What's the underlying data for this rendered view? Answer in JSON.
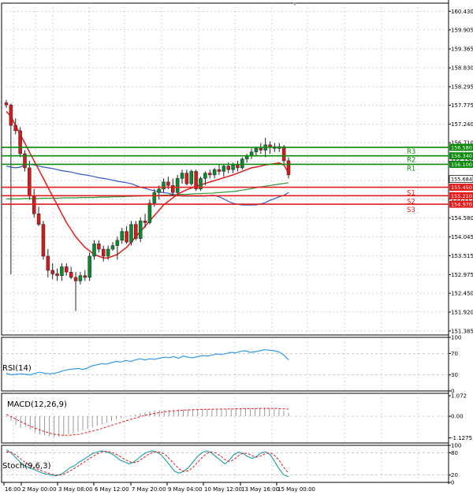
{
  "colors": {
    "background": "#ffffff",
    "grid": "#b8b8b8",
    "panel_border": "#000000",
    "bull_candle": "#0a8a2e",
    "bear_candle": "#d61a1a",
    "ema_red": "#e31b1b",
    "ma_blue": "#3355cc",
    "ma_green": "#2a9a3a",
    "resistance": "#0a8a0a",
    "support": "#e31b1b",
    "price_tag": "#ffffff",
    "rsi": "#3399ee",
    "macd_hist": "#999999",
    "macd_signal": "#e31b1b",
    "stoch_main": "#1aa0a0",
    "stoch_signal": "#e31b1b"
  },
  "chart_data": {
    "type": "candlestick",
    "price_panel": {
      "ylim": [
        151.27,
        160.66
      ],
      "price_ticks": [
        "160.430",
        "159.905",
        "159.365",
        "158.830",
        "158.295",
        "157.775",
        "157.240",
        "156.710",
        "156.175",
        "155.640",
        "155.115",
        "154.580",
        "154.045",
        "153.515",
        "152.975",
        "152.450",
        "151.920",
        "151.385"
      ],
      "candles": [
        {
          "o": 157.84,
          "h": 157.92,
          "l": 157.7,
          "c": 157.78
        },
        {
          "o": 157.78,
          "h": 157.82,
          "l": 152.99,
          "c": 157.2
        },
        {
          "o": 157.2,
          "h": 157.4,
          "l": 156.95,
          "c": 157.05
        },
        {
          "o": 157.05,
          "h": 157.15,
          "l": 156.3,
          "c": 156.4
        },
        {
          "o": 156.4,
          "h": 156.5,
          "l": 155.9,
          "c": 156.0
        },
        {
          "o": 156.0,
          "h": 156.2,
          "l": 155.1,
          "c": 155.2
        },
        {
          "o": 155.2,
          "h": 155.4,
          "l": 154.6,
          "c": 154.7
        },
        {
          "o": 154.7,
          "h": 154.9,
          "l": 154.35,
          "c": 154.4
        },
        {
          "o": 154.4,
          "h": 154.5,
          "l": 153.4,
          "c": 153.5
        },
        {
          "o": 153.5,
          "h": 153.7,
          "l": 152.9,
          "c": 153.1
        },
        {
          "o": 153.1,
          "h": 153.3,
          "l": 152.85,
          "c": 153.0
        },
        {
          "o": 153.0,
          "h": 153.15,
          "l": 152.8,
          "c": 152.95
        },
        {
          "o": 152.95,
          "h": 153.3,
          "l": 152.8,
          "c": 153.2
        },
        {
          "o": 153.2,
          "h": 153.3,
          "l": 152.95,
          "c": 153.05
        },
        {
          "o": 153.05,
          "h": 153.2,
          "l": 152.85,
          "c": 152.9
        },
        {
          "o": 152.9,
          "h": 153.05,
          "l": 151.95,
          "c": 152.8
        },
        {
          "o": 152.8,
          "h": 153.05,
          "l": 152.7,
          "c": 152.95
        },
        {
          "o": 152.95,
          "h": 153.1,
          "l": 152.8,
          "c": 152.9
        },
        {
          "o": 152.9,
          "h": 153.6,
          "l": 152.8,
          "c": 153.5
        },
        {
          "o": 153.5,
          "h": 153.95,
          "l": 153.4,
          "c": 153.85
        },
        {
          "o": 153.85,
          "h": 153.95,
          "l": 153.6,
          "c": 153.7
        },
        {
          "o": 153.7,
          "h": 153.8,
          "l": 153.35,
          "c": 153.5
        },
        {
          "o": 153.5,
          "h": 153.8,
          "l": 153.4,
          "c": 153.7
        },
        {
          "o": 153.7,
          "h": 153.9,
          "l": 153.65,
          "c": 153.8
        },
        {
          "o": 153.8,
          "h": 154.05,
          "l": 153.4,
          "c": 153.95
        },
        {
          "o": 153.95,
          "h": 154.3,
          "l": 153.85,
          "c": 154.2
        },
        {
          "o": 154.2,
          "h": 154.35,
          "l": 153.85,
          "c": 153.9
        },
        {
          "o": 153.9,
          "h": 154.5,
          "l": 153.8,
          "c": 154.4
        },
        {
          "o": 154.4,
          "h": 154.5,
          "l": 153.95,
          "c": 154.0
        },
        {
          "o": 154.0,
          "h": 154.6,
          "l": 153.9,
          "c": 154.5
        },
        {
          "o": 154.5,
          "h": 154.7,
          "l": 154.3,
          "c": 154.45
        },
        {
          "o": 154.45,
          "h": 155.1,
          "l": 154.4,
          "c": 155.0
        },
        {
          "o": 155.0,
          "h": 155.4,
          "l": 154.9,
          "c": 155.3
        },
        {
          "o": 155.3,
          "h": 155.5,
          "l": 155.1,
          "c": 155.4
        },
        {
          "o": 155.4,
          "h": 155.7,
          "l": 155.3,
          "c": 155.6
        },
        {
          "o": 155.6,
          "h": 155.75,
          "l": 155.4,
          "c": 155.5
        },
        {
          "o": 155.5,
          "h": 155.7,
          "l": 155.2,
          "c": 155.3
        },
        {
          "o": 155.3,
          "h": 155.8,
          "l": 155.25,
          "c": 155.7
        },
        {
          "o": 155.7,
          "h": 155.95,
          "l": 155.55,
          "c": 155.85
        },
        {
          "o": 155.85,
          "h": 155.95,
          "l": 155.5,
          "c": 155.55
        },
        {
          "o": 155.55,
          "h": 155.95,
          "l": 155.5,
          "c": 155.9
        },
        {
          "o": 155.9,
          "h": 155.95,
          "l": 155.35,
          "c": 155.4
        },
        {
          "o": 155.4,
          "h": 155.75,
          "l": 155.35,
          "c": 155.7
        },
        {
          "o": 155.7,
          "h": 155.9,
          "l": 155.5,
          "c": 155.85
        },
        {
          "o": 155.85,
          "h": 155.95,
          "l": 155.7,
          "c": 155.8
        },
        {
          "o": 155.8,
          "h": 156.0,
          "l": 155.7,
          "c": 155.95
        },
        {
          "o": 155.95,
          "h": 156.1,
          "l": 155.8,
          "c": 155.9
        },
        {
          "o": 155.9,
          "h": 156.1,
          "l": 155.75,
          "c": 156.05
        },
        {
          "o": 156.05,
          "h": 156.15,
          "l": 155.85,
          "c": 155.95
        },
        {
          "o": 155.95,
          "h": 156.15,
          "l": 155.85,
          "c": 156.1
        },
        {
          "o": 156.1,
          "h": 156.2,
          "l": 155.9,
          "c": 156.0
        },
        {
          "o": 156.0,
          "h": 156.3,
          "l": 155.95,
          "c": 156.25
        },
        {
          "o": 156.25,
          "h": 156.4,
          "l": 156.15,
          "c": 156.35
        },
        {
          "o": 156.35,
          "h": 156.55,
          "l": 156.25,
          "c": 156.45
        },
        {
          "o": 156.45,
          "h": 156.6,
          "l": 156.35,
          "c": 156.55
        },
        {
          "o": 156.55,
          "h": 156.7,
          "l": 156.4,
          "c": 156.5
        },
        {
          "o": 156.5,
          "h": 156.85,
          "l": 156.3,
          "c": 156.65
        },
        {
          "o": 156.65,
          "h": 156.75,
          "l": 156.4,
          "c": 156.6
        },
        {
          "o": 156.6,
          "h": 156.7,
          "l": 156.45,
          "c": 156.55
        },
        {
          "o": 156.55,
          "h": 156.7,
          "l": 156.45,
          "c": 156.6
        },
        {
          "o": 156.6,
          "h": 156.65,
          "l": 156.1,
          "c": 156.2
        },
        {
          "o": 156.2,
          "h": 156.3,
          "l": 155.7,
          "c": 155.8
        }
      ],
      "indicator_lines": {
        "ema_red": [
          157.6,
          157.45,
          157.2,
          156.95,
          156.7,
          156.45,
          156.2,
          155.95,
          155.7,
          155.45,
          155.2,
          154.95,
          154.7,
          154.45,
          154.25,
          154.05,
          153.9,
          153.75,
          153.65,
          153.55,
          153.5,
          153.45,
          153.45,
          153.5,
          153.55,
          153.65,
          153.75,
          153.9,
          154.05,
          154.2,
          154.35,
          154.5,
          154.65,
          154.8,
          154.95,
          155.05,
          155.15,
          155.25,
          155.32,
          155.38,
          155.43,
          155.48,
          155.52,
          155.56,
          155.6,
          155.64,
          155.68,
          155.72,
          155.76,
          155.8,
          155.85,
          155.9,
          155.95,
          156.0,
          156.02,
          156.05,
          156.08,
          156.1,
          156.12,
          156.14,
          156.08,
          155.85
        ],
        "ma_blue": [
          156.05,
          156.02,
          156.0,
          156.02,
          156.08,
          156.1,
          156.08,
          156.05,
          156.02,
          156.0,
          155.98,
          155.95,
          155.92,
          155.9,
          155.88,
          155.85,
          155.82,
          155.8,
          155.78,
          155.75,
          155.72,
          155.7,
          155.68,
          155.65,
          155.62,
          155.6,
          155.58,
          155.55,
          155.5,
          155.45,
          155.42,
          155.38,
          155.35,
          155.32,
          155.3,
          155.28,
          155.25,
          155.22,
          155.2,
          155.2,
          155.2,
          155.2,
          155.2,
          155.2,
          155.22,
          155.22,
          155.18,
          155.12,
          155.05,
          155.0,
          154.97,
          154.95,
          154.95,
          154.95,
          154.95,
          154.98,
          155.02,
          155.08,
          155.13,
          155.18,
          155.22,
          155.3
        ],
        "ma_green": [
          155.12,
          155.12,
          155.12,
          155.12,
          155.13,
          155.13,
          155.13,
          155.13,
          155.14,
          155.14,
          155.14,
          155.14,
          155.15,
          155.15,
          155.15,
          155.15,
          155.16,
          155.16,
          155.16,
          155.16,
          155.17,
          155.17,
          155.17,
          155.18,
          155.18,
          155.18,
          155.19,
          155.19,
          155.2,
          155.2,
          155.21,
          155.21,
          155.22,
          155.22,
          155.23,
          155.23,
          155.24,
          155.24,
          155.25,
          155.25,
          155.26,
          155.27,
          155.27,
          155.28,
          155.28,
          155.29,
          155.3,
          155.31,
          155.32,
          155.33,
          155.35,
          155.37,
          155.39,
          155.41,
          155.44,
          155.46,
          155.48,
          155.5,
          155.52,
          155.54,
          155.56,
          155.58
        ]
      },
      "levels": [
        {
          "label": "R3",
          "value": 156.58,
          "value_text": "156.580",
          "kind": "resistance"
        },
        {
          "label": "R2",
          "value": 156.34,
          "value_text": "156.340",
          "kind": "resistance"
        },
        {
          "label": "R1",
          "value": 156.1,
          "value_text": "156.100",
          "kind": "resistance"
        },
        {
          "label": "S1",
          "value": 155.45,
          "value_text": "155.450",
          "kind": "support"
        },
        {
          "label": "S2",
          "value": 155.21,
          "value_text": "155.210",
          "kind": "support"
        },
        {
          "label": "S3",
          "value": 154.97,
          "value_text": "154.970",
          "kind": "support"
        }
      ],
      "current_price": {
        "value": 155.684,
        "text": "155.684"
      }
    },
    "rsi_panel": {
      "label": "RSI(14)",
      "ylim": [
        0,
        100
      ],
      "ticks": [
        "100",
        "70",
        "30",
        "0"
      ],
      "levels": [
        70,
        30
      ],
      "values": [
        33,
        30,
        31,
        32,
        31,
        30,
        33,
        35,
        33,
        32,
        33,
        35,
        38,
        40,
        41,
        42,
        40,
        43,
        47,
        49,
        51,
        50,
        53,
        55,
        54,
        57,
        55,
        58,
        60,
        58,
        60,
        59,
        61,
        63,
        62,
        64,
        61,
        65,
        63,
        62,
        64,
        66,
        65,
        67,
        69,
        68,
        70,
        72,
        71,
        74,
        75,
        72,
        73,
        75,
        77,
        76,
        75,
        73,
        67,
        58
      ]
    },
    "macd_panel": {
      "label": "MACD(12,26,9)",
      "ylim": [
        -1.4,
        1.2
      ],
      "ticks": [
        "1.072",
        "0.00",
        "-1.1275"
      ],
      "histogram": [
        -0.05,
        -0.25,
        -0.45,
        -0.6,
        -0.55,
        -0.7,
        -0.85,
        -0.95,
        -1.0,
        -1.05,
        -1.1,
        -1.08,
        -1.02,
        -0.95,
        -0.9,
        -0.82,
        -0.74,
        -0.66,
        -0.58,
        -0.5,
        -0.42,
        -0.34,
        -0.26,
        -0.18,
        -0.1,
        -0.02,
        0.04,
        0.1,
        0.16,
        0.22,
        0.26,
        0.3,
        0.32,
        0.34,
        0.35,
        0.35,
        0.36,
        0.36,
        0.37,
        0.37,
        0.37,
        0.38,
        0.38,
        0.38,
        0.38,
        0.39,
        0.39,
        0.39,
        0.4,
        0.4,
        0.41,
        0.41,
        0.42,
        0.42,
        0.42,
        0.41,
        0.4,
        0.38,
        0.3,
        0.18
      ],
      "signal": [
        0.1,
        -0.02,
        -0.15,
        -0.28,
        -0.4,
        -0.52,
        -0.62,
        -0.72,
        -0.8,
        -0.88,
        -0.94,
        -0.98,
        -1.0,
        -1.0,
        -0.98,
        -0.95,
        -0.9,
        -0.84,
        -0.78,
        -0.71,
        -0.64,
        -0.56,
        -0.48,
        -0.4,
        -0.32,
        -0.24,
        -0.16,
        -0.09,
        -0.02,
        0.05,
        0.1,
        0.15,
        0.19,
        0.23,
        0.26,
        0.28,
        0.3,
        0.32,
        0.33,
        0.34,
        0.35,
        0.36,
        0.36,
        0.37,
        0.37,
        0.38,
        0.38,
        0.38,
        0.39,
        0.39,
        0.4,
        0.4,
        0.4,
        0.41,
        0.41,
        0.41,
        0.41,
        0.4,
        0.39,
        0.37
      ]
    },
    "stoch_panel": {
      "label": "Stoch(9,6,3)",
      "ylim": [
        0,
        100
      ],
      "ticks": [
        "100",
        "80",
        "20",
        "0"
      ],
      "levels": [
        80,
        20
      ],
      "main": [
        88,
        80,
        68,
        55,
        45,
        40,
        35,
        30,
        25,
        22,
        20,
        18,
        22,
        30,
        40,
        45,
        55,
        62,
        70,
        78,
        82,
        85,
        82,
        78,
        70,
        60,
        55,
        50,
        55,
        65,
        75,
        82,
        85,
        82,
        75,
        60,
        45,
        30,
        25,
        30,
        40,
        55,
        70,
        80,
        85,
        80,
        70,
        60,
        50,
        60,
        75,
        82,
        78,
        70,
        65,
        70,
        80,
        82,
        75,
        55,
        35,
        20,
        15
      ],
      "signal": [
        82,
        82,
        75,
        65,
        55,
        47,
        40,
        35,
        30,
        26,
        22,
        20,
        20,
        24,
        31,
        38,
        46,
        54,
        62,
        70,
        77,
        82,
        84,
        82,
        77,
        70,
        62,
        56,
        53,
        57,
        65,
        74,
        80,
        83,
        81,
        74,
        62,
        48,
        36,
        30,
        31,
        40,
        54,
        67,
        78,
        82,
        80,
        72,
        62,
        56,
        61,
        72,
        79,
        78,
        72,
        68,
        72,
        78,
        80,
        72,
        58,
        40,
        25
      ]
    },
    "x_ticks": [
      "16:00",
      "2 May 00:00",
      "3 May 08:00",
      "6 May 12:00",
      "7 May 20:00",
      "9 May 04:00",
      "10 May 12:00",
      "13 May 16:00",
      "15 May 00:00"
    ]
  }
}
